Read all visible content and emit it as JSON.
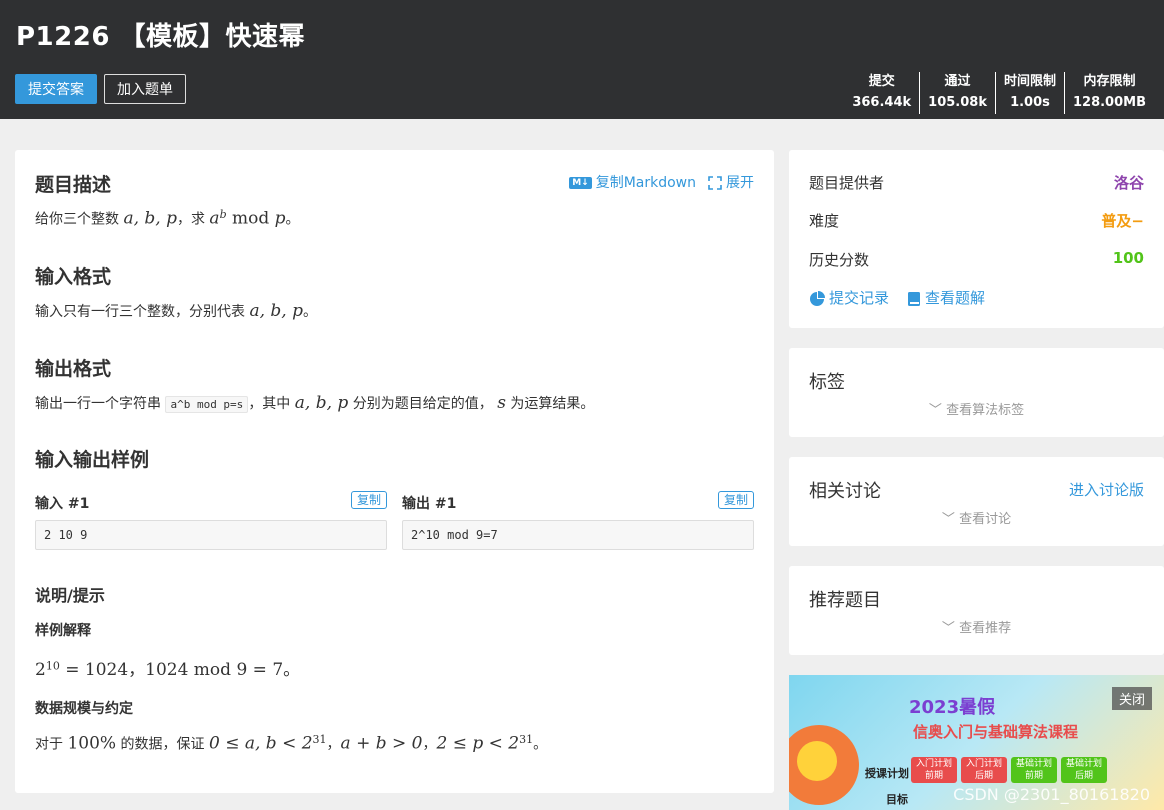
{
  "header": {
    "title": "P1226 【模板】快速幂",
    "submit_label": "提交答案",
    "add_label": "加入题单",
    "stats": [
      {
        "label": "提交",
        "value": "366.44k"
      },
      {
        "label": "通过",
        "value": "105.08k"
      },
      {
        "label": "时间限制",
        "value": "1.00s"
      },
      {
        "label": "内存限制",
        "value": "128.00MB"
      }
    ]
  },
  "main": {
    "copy_markdown": "复制Markdown",
    "md_badge": "M↓",
    "expand": "展开",
    "desc_title": "题目描述",
    "desc_pre": "给你三个整数 ",
    "desc_vars": "a, b, p",
    "desc_mid": "，求 ",
    "desc_expr": "a",
    "desc_sup": "b",
    "desc_mod": " mod ",
    "desc_p": "p",
    "desc_end": "。",
    "input_title": "输入格式",
    "input_pre": "输入只有一行三个整数，分别代表 ",
    "input_vars": "a, b, p",
    "input_end": "。",
    "output_title": "输出格式",
    "output_pre": "输出一行一个字符串 ",
    "output_code": "a^b mod p=s",
    "output_mid": "，其中 ",
    "output_vars": "a, b, p",
    "output_mid2": " 分别为题目给定的值， ",
    "output_s": "s",
    "output_end": " 为运算结果。",
    "samples_title": "输入输出样例",
    "sample_in_label": "输入 #1",
    "sample_out_label": "输出 #1",
    "copy": "复制",
    "sample_in": "2 10 9",
    "sample_out": "2^10 mod 9=7",
    "hint_title": "说明/提示",
    "explain_title": "样例解释",
    "explain_base": "2",
    "explain_sup": "10",
    "explain_rest": " = 1024，1024 mod 9 = 7。",
    "limits_title": "数据规模与约定",
    "limits_pre": "对于 ",
    "limits_pct": "100%",
    "limits_mid": " 的数据，保证 ",
    "limits_expr1": "0 ≤ a, b < 2",
    "limits_sup1": "31",
    "limits_sep1": "，",
    "limits_expr2": "a + b > 0",
    "limits_sep2": "，",
    "limits_expr3": "2 ≤ p < 2",
    "limits_sup3": "31",
    "limits_end": "。"
  },
  "info": {
    "provider_label": "题目提供者",
    "provider": "洛谷",
    "difficulty_label": "难度",
    "difficulty": "普及−",
    "score_label": "历史分数",
    "score": "100",
    "records": "提交记录",
    "solutions": "查看题解",
    "colors": {
      "provider": "#8e44ad",
      "difficulty": "#f39c11",
      "score": "#52c41a"
    }
  },
  "tags": {
    "title": "标签",
    "sub": "查看算法标签"
  },
  "discuss": {
    "title": "相关讨论",
    "link": "进入讨论版",
    "sub": "查看讨论"
  },
  "recommend": {
    "title": "推荐题目",
    "sub": "查看推荐"
  },
  "ad": {
    "close": "关闭",
    "headline": "2023暑假",
    "subline": "信奥入门与基础算法课程",
    "plan": "授课计划",
    "goal": "目标",
    "chips": [
      "入门计划\n前期",
      "入门计划\n后期",
      "基础计划\n前期",
      "基础计划\n后期"
    ],
    "watermark": "CSDN @2301_80161820"
  }
}
